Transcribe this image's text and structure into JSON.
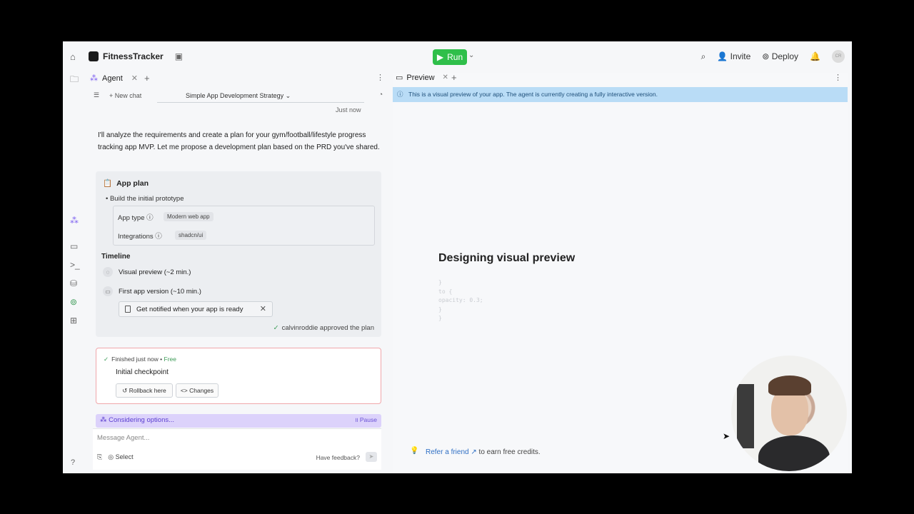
{
  "topbar": {
    "app_name": "FitnessTracker",
    "run_label": "Run",
    "invite_label": "Invite",
    "deploy_label": "Deploy",
    "avatar_initials": "CR"
  },
  "agent_panel": {
    "tab_label": "Agent",
    "new_chat_label": "New chat",
    "chat_title": "Simple App Development Strategy",
    "timestamp": "Just now",
    "message": "I'll analyze the requirements and create a plan for your gym/football/lifestyle progress tracking app MVP. Let me propose a development plan based on the PRD you've shared.",
    "plan": {
      "title": "App plan",
      "bullet": "Build the initial prototype",
      "app_type_label": "App type",
      "app_type_value": "Modern web app",
      "integrations_label": "Integrations",
      "integrations_value": "shadcn/ui",
      "timeline_label": "Timeline",
      "timeline_items": [
        "Visual preview (~2 min.)",
        "First app version (~10 min.)"
      ],
      "notify_label": "Get notified when your app is ready",
      "approved_text": "calvinroddie approved the plan"
    },
    "checkpoint": {
      "status": "Finished just now",
      "free_label": "Free",
      "title": "Initial checkpoint",
      "rollback_label": "Rollback here",
      "changes_label": "Changes"
    },
    "considering": {
      "label": "Considering options...",
      "pause_label": "Pause"
    },
    "input": {
      "placeholder": "Message Agent...",
      "select_label": "Select",
      "feedback_label": "Have feedback?"
    }
  },
  "preview_panel": {
    "tab_label": "Preview",
    "banner": "This is a visual preview of your app. The agent is currently creating a fully interactive version.",
    "heading": "Designing visual preview",
    "code_lines": [
      "}",
      "to {",
      "opacity: 0.3;",
      "}",
      "}"
    ],
    "refer_link": "Refer a friend",
    "refer_suffix": "to earn free credits."
  }
}
